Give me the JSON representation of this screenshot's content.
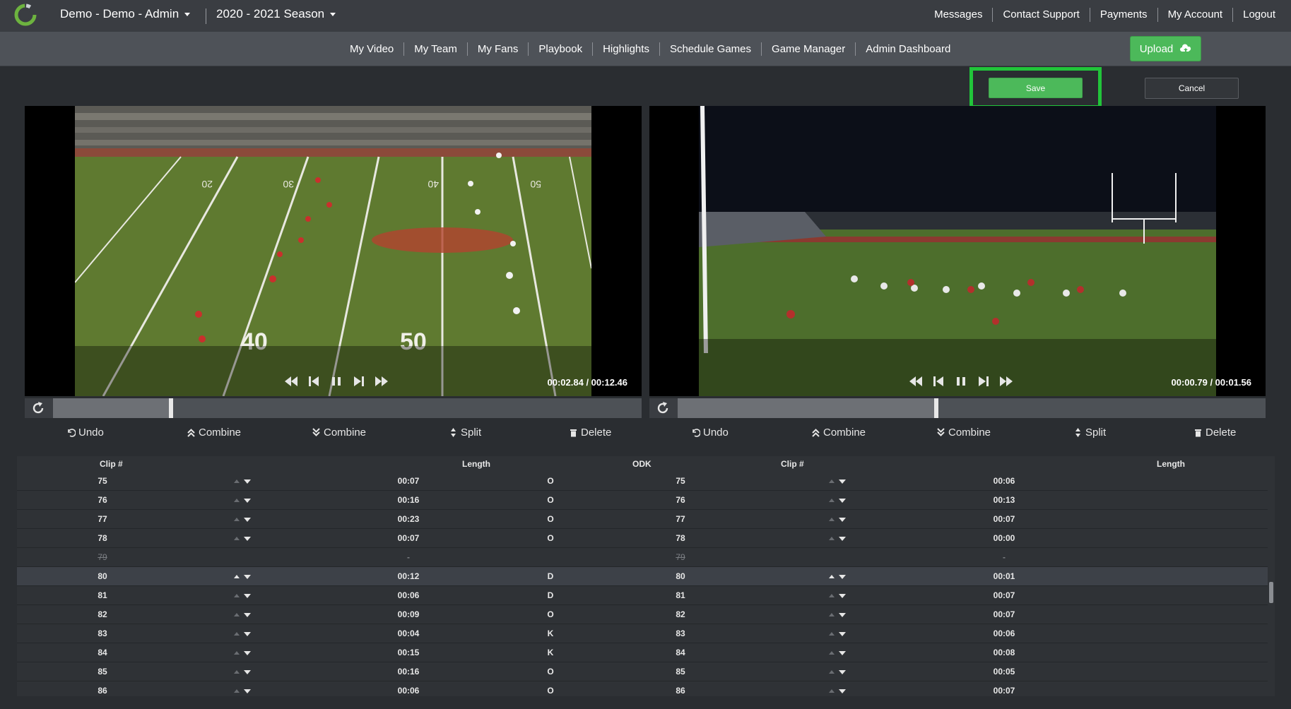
{
  "topbar": {
    "org_selector": "Demo - Demo - Admin",
    "season_selector": "2020 - 2021 Season",
    "links": [
      "Messages",
      "Contact Support",
      "Payments",
      "My Account",
      "Logout"
    ]
  },
  "navbar": {
    "links": [
      "My Video",
      "My Team",
      "My Fans",
      "Playbook",
      "Highlights",
      "Schedule Games",
      "Game Manager",
      "Admin Dashboard"
    ],
    "upload_label": "Upload"
  },
  "editor": {
    "save_label": "Save",
    "cancel_label": "Cancel"
  },
  "left_player": {
    "timecode": "00:02.84 / 00:12.46",
    "progress_fraction": 0.2
  },
  "right_player": {
    "timecode": "00:00.79 / 00:01.56",
    "progress_fraction": 0.44
  },
  "actions": {
    "undo": "Undo",
    "combine_up": "Combine",
    "combine_down": "Combine",
    "split": "Split",
    "delete": "Delete"
  },
  "table": {
    "headers": {
      "left_clip": "Clip #",
      "left_length": "Length",
      "odk": "ODK",
      "right_clip": "Clip #",
      "right_length": "Length"
    },
    "rows": [
      {
        "left_clip": "75",
        "left_length": "00:07",
        "odk": "O",
        "right_clip": "75",
        "right_length": "00:06"
      },
      {
        "left_clip": "76",
        "left_length": "00:16",
        "odk": "O",
        "right_clip": "76",
        "right_length": "00:13"
      },
      {
        "left_clip": "77",
        "left_length": "00:23",
        "odk": "O",
        "right_clip": "77",
        "right_length": "00:07"
      },
      {
        "left_clip": "78",
        "left_length": "00:07",
        "odk": "O",
        "right_clip": "78",
        "right_length": "00:00"
      },
      {
        "left_clip": "79",
        "left_length": "-",
        "odk": "",
        "right_clip": "79",
        "right_length": "-",
        "deleted": true
      },
      {
        "left_clip": "80",
        "left_length": "00:12",
        "odk": "D",
        "right_clip": "80",
        "right_length": "00:01",
        "selected": true
      },
      {
        "left_clip": "81",
        "left_length": "00:06",
        "odk": "D",
        "right_clip": "81",
        "right_length": "00:07"
      },
      {
        "left_clip": "82",
        "left_length": "00:09",
        "odk": "O",
        "right_clip": "82",
        "right_length": "00:07"
      },
      {
        "left_clip": "83",
        "left_length": "00:04",
        "odk": "K",
        "right_clip": "83",
        "right_length": "00:06"
      },
      {
        "left_clip": "84",
        "left_length": "00:15",
        "odk": "K",
        "right_clip": "84",
        "right_length": "00:08"
      },
      {
        "left_clip": "85",
        "left_length": "00:16",
        "odk": "O",
        "right_clip": "85",
        "right_length": "00:05"
      },
      {
        "left_clip": "86",
        "left_length": "00:06",
        "odk": "O",
        "right_clip": "86",
        "right_length": "00:07"
      }
    ]
  },
  "video_left_markings": [
    "40",
    "50",
    "20",
    "30",
    "40",
    "50"
  ],
  "colors": {
    "accent_green": "#4cb95a",
    "highlight_green": "#21c43a",
    "topbar": "#3a3d42",
    "navbar": "#4e5258",
    "background": "#2a2d31"
  }
}
